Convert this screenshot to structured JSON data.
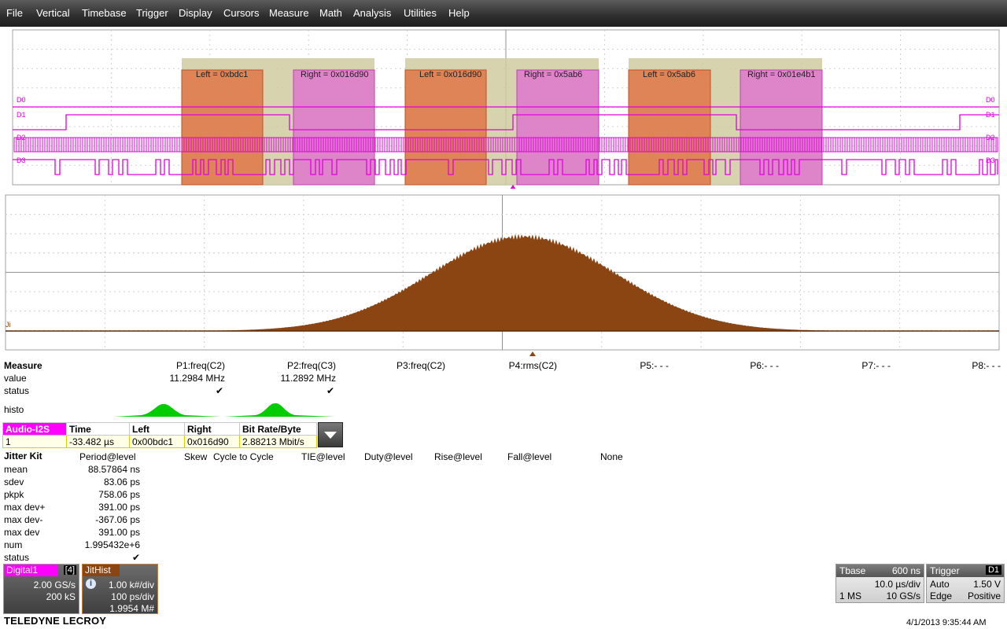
{
  "menu": [
    "File",
    "Vertical",
    "Timebase",
    "Trigger",
    "Display",
    "Cursors",
    "Measure",
    "Math",
    "Analysis",
    "Utilities",
    "Help"
  ],
  "decode": {
    "groups": [
      {
        "left": "Left = 0xbdc1",
        "right": "Right = 0x016d90"
      },
      {
        "left": "Left = 0x016d90",
        "right": "Right = 0x5ab6"
      },
      {
        "left": "Left = 0x5ab6",
        "right": "Right = 0x01e4b1"
      }
    ],
    "channels": [
      "D0",
      "D1",
      "D2",
      "D3"
    ],
    "hist_label": "Ji"
  },
  "colors": {
    "digital": "#e000e0",
    "hist": "#8b4513",
    "left_box": "#e07040",
    "right_box": "#e070d0",
    "tan": "#cfcba0",
    "histo_green": "#00cc00"
  },
  "measure": {
    "title": "Measure",
    "row_labels": [
      "value",
      "status",
      "histo"
    ],
    "params": [
      {
        "name": "P1:freq(C2)",
        "value": "11.2984 MHz",
        "status": "✔"
      },
      {
        "name": "P2:freq(C3)",
        "value": "11.2892 MHz",
        "status": "✔"
      },
      {
        "name": "P3:freq(C2)",
        "value": "",
        "status": ""
      },
      {
        "name": "P4:rms(C2)",
        "value": "",
        "status": ""
      },
      {
        "name": "P5:- - -",
        "value": "",
        "status": ""
      },
      {
        "name": "P6:- - -",
        "value": "",
        "status": ""
      },
      {
        "name": "P7:- - -",
        "value": "",
        "status": ""
      },
      {
        "name": "P8:- - -",
        "value": "",
        "status": ""
      }
    ]
  },
  "table": {
    "name": "Audio-I2S",
    "headers": [
      "Time",
      "Left",
      "Right",
      "Bit Rate/Byte"
    ],
    "row": {
      "index": "1",
      "time": "-33.482 µs",
      "left": "0x00bdc1",
      "right": "0x016d90",
      "bitrate": "2.88213 Mbit/s"
    }
  },
  "jitter": {
    "title": "Jitter Kit",
    "tabs": [
      "Period@level",
      "Skew",
      "Cycle to Cycle",
      "TIE@level",
      "Duty@level",
      "Rise@level",
      "Fall@level",
      "None"
    ],
    "rows": [
      {
        "label": "mean",
        "value": "88.57864 ns"
      },
      {
        "label": "sdev",
        "value": "83.06 ps"
      },
      {
        "label": "pkpk",
        "value": "758.06 ps"
      },
      {
        "label": "max dev+",
        "value": "391.00 ps"
      },
      {
        "label": "max dev-",
        "value": "-367.06 ps"
      },
      {
        "label": "max dev",
        "value": "391.00 ps"
      },
      {
        "label": "num",
        "value": "1.995432e+6"
      },
      {
        "label": "status",
        "value": "✔"
      }
    ]
  },
  "descriptors": {
    "digital": {
      "name": "Digital1",
      "badge": "[4]",
      "line1": "2.00 GS/s",
      "line2": "200 kS"
    },
    "jithist": {
      "name": "JitHist",
      "line1": "1.00 k#/div",
      "line2": "100 ps/div",
      "line3": "1.9954 M#"
    },
    "tbase": {
      "label": "Tbase",
      "value": "600 ns",
      "line1": "10.0 µs/div",
      "line2_left": "1 MS",
      "line2_right": "10 GS/s"
    },
    "trigger": {
      "label": "Trigger",
      "badge": "D1",
      "mode": "Auto",
      "level": "1.50 V",
      "type": "Edge",
      "slope": "Positive"
    }
  },
  "footer": {
    "brand": "TELEDYNE LECROY",
    "datetime": "4/1/2013 9:35:44 AM"
  }
}
